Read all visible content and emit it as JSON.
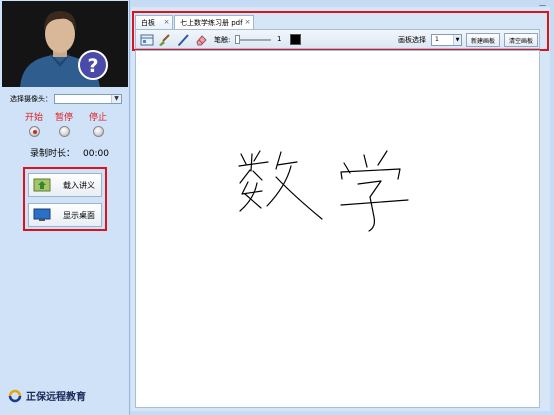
{
  "camera": {
    "label": "选择摄像头：",
    "value": ""
  },
  "controls": {
    "start": "开始",
    "pause": "暂停",
    "stop": "停止"
  },
  "recording": {
    "label": "录制时长：",
    "value": "00:00"
  },
  "left_buttons": {
    "load": "载入讲义",
    "desktop": "显示桌面"
  },
  "brand": {
    "name": "正保远程教育"
  },
  "tabs": [
    {
      "label": "白板",
      "close": "×"
    },
    {
      "label": "七上数学练习册 pdf",
      "close": "×"
    }
  ],
  "toolbar": {
    "brush_label": "笔触:",
    "brush_value": "1",
    "page_select_label": "画板选择",
    "page_value": "1",
    "new_board": "新建画板",
    "clear_board": "清空画板"
  },
  "window": {
    "minimize": "—"
  },
  "handwriting": "数学",
  "colors": {
    "highlight": "#d9141c",
    "accent_red": "#e02020",
    "pen": "#000000"
  }
}
